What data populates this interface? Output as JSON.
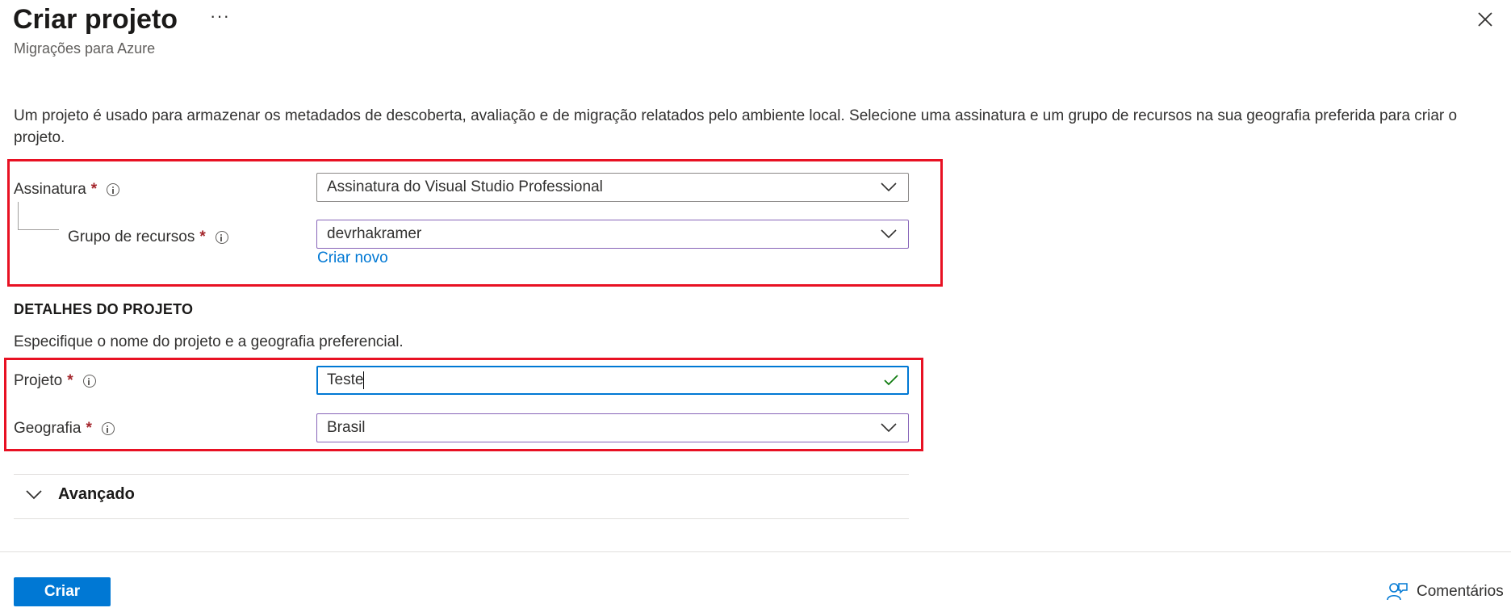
{
  "header": {
    "title": "Criar projeto",
    "subtitle": "Migrações para Azure",
    "more_icon": "ellipsis-icon",
    "close_icon": "close-icon"
  },
  "description": "Um projeto é usado para armazenar os metadados de descoberta, avaliação e de migração relatados pelo ambiente local. Selecione uma assinatura e um grupo de recursos na sua geografia preferida para criar o projeto.",
  "subscription_section": {
    "subscription": {
      "label": "Assinatura",
      "required_mark": "*",
      "value": "Assinatura do Visual Studio Professional"
    },
    "resource_group": {
      "label": "Grupo de recursos",
      "required_mark": "*",
      "value": "devrhakramer",
      "create_new_link": "Criar novo"
    }
  },
  "project_details": {
    "heading": "DETALHES DO PROJETO",
    "description": "Especifique o nome do projeto e a geografia preferencial.",
    "project": {
      "label": "Projeto",
      "required_mark": "*",
      "value": "Teste"
    },
    "geography": {
      "label": "Geografia",
      "required_mark": "*",
      "value": "Brasil"
    }
  },
  "advanced": {
    "label": "Avançado",
    "expanded": false
  },
  "footer": {
    "create_button": "Criar",
    "feedback_label": "Comentários",
    "feedback_icon": "feedback-icon"
  },
  "colors": {
    "accent": "#0078d4",
    "highlight_box": "#e81123",
    "required": "#a4262c",
    "valid_check": "#107c10",
    "dropdown_border_active": "#8764b8"
  }
}
